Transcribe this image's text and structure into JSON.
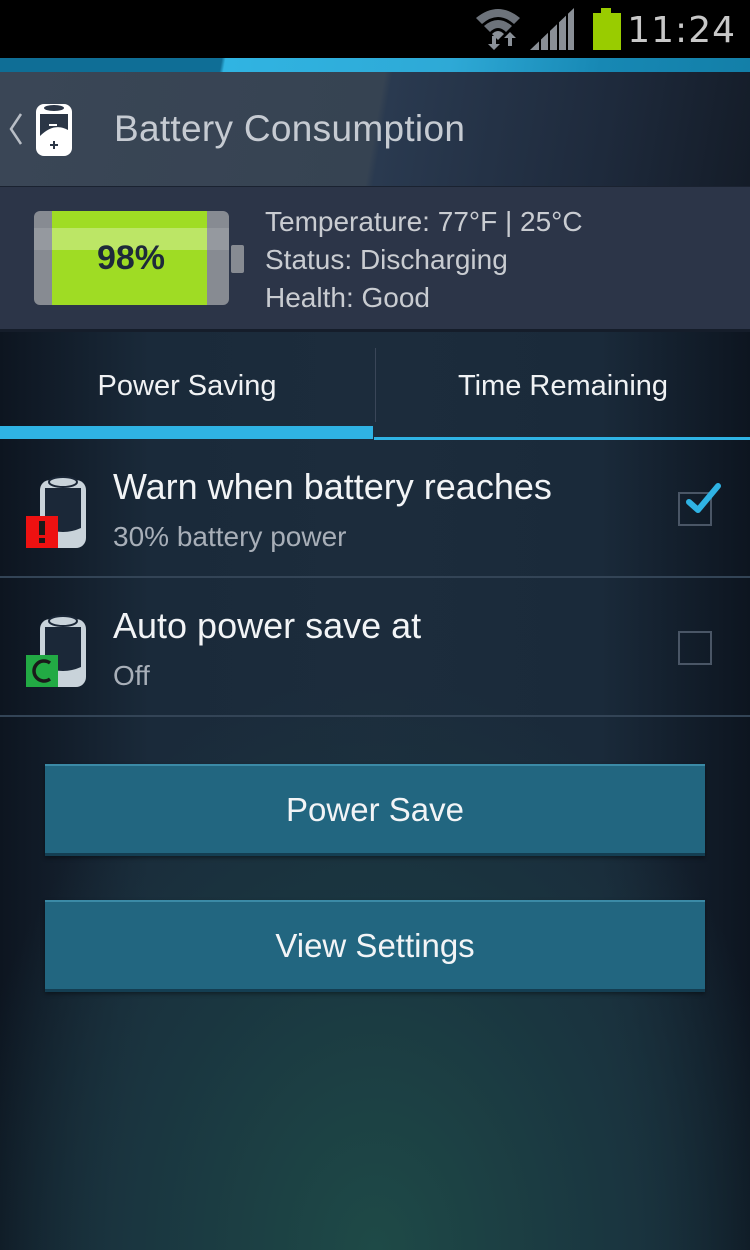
{
  "status_bar": {
    "time": "11:24",
    "icons": [
      "wifi-data-icon",
      "signal-strength-icon",
      "battery-full-icon"
    ],
    "battery_color": "#99cc00"
  },
  "action_bar": {
    "back_icon": "chevron-left-icon",
    "app_icon": "battery-icon",
    "title": "Battery Consumption",
    "accent_color": "#2fb3e4"
  },
  "battery_info": {
    "level_percent": 98,
    "level_label": "98%",
    "fill_color": "#9fdc24",
    "temperature": "Temperature: 77°F | 25°C",
    "status": "Status: Discharging",
    "health": "Health: Good"
  },
  "tabs": [
    {
      "label": "Power Saving",
      "active": true
    },
    {
      "label": "Time Remaining",
      "active": false
    }
  ],
  "settings": [
    {
      "title": "Warn when battery reaches",
      "subtitle": "30% battery power",
      "checked": true,
      "icon": "battery-warning-icon",
      "badge_color": "#ee1111"
    },
    {
      "title": "Auto power save at",
      "subtitle": "Off",
      "checked": false,
      "icon": "battery-auto-save-icon",
      "badge_color": "#22aa44"
    }
  ],
  "buttons": {
    "power_save": "Power Save",
    "view_settings": "View Settings"
  }
}
